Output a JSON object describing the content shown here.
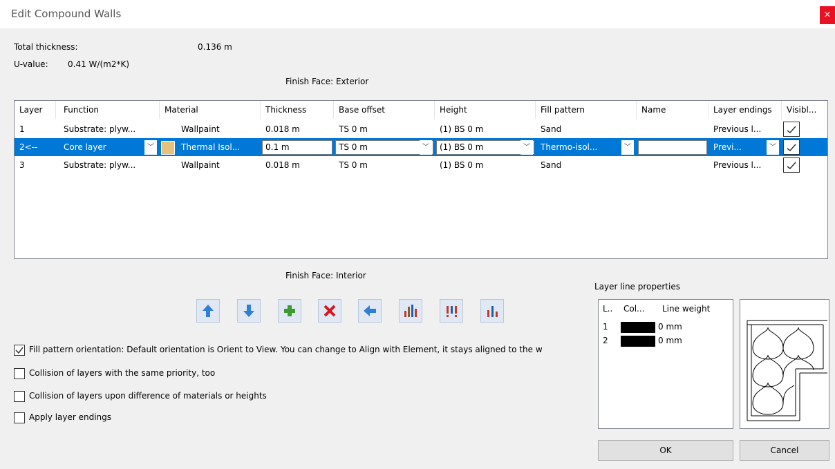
{
  "window": {
    "title": "Edit Compound Walls",
    "close_glyph": "×"
  },
  "summary": {
    "total_thickness_label": "Total thickness:",
    "total_thickness_value": "0.136 m",
    "u_value_label": "U-value:",
    "u_value_value": "0.41 W/(m2*K)"
  },
  "finish_exterior": "Finish Face: Exterior",
  "finish_interior": "Finish Face: Interior",
  "columns": [
    "Layer",
    "Function",
    "Material",
    "Thickness",
    "Base offset",
    "Height",
    "Fill pattern",
    "Name",
    "Layer endings",
    "Visibl..."
  ],
  "rows": [
    {
      "layer": "1",
      "function": "Substrate: plyw...",
      "material": "Wallpaint",
      "thickness": "0.018 m",
      "base_offset": "TS 0 m",
      "height": "(1) BS 0 m",
      "fill_pattern": "Sand",
      "name": "",
      "layer_endings": "Previous l...",
      "visible": true
    },
    {
      "layer": "2<--",
      "function": "Core layer",
      "material": "Thermal Isol...",
      "thickness": "0.1 m",
      "base_offset": "TS 0 m",
      "height": "(1) BS 0 m",
      "fill_pattern": "Thermo-isol...",
      "name": "",
      "layer_endings": "Previ...",
      "visible": true,
      "selected": true,
      "swatch_color": "#e8c27a"
    },
    {
      "layer": "3",
      "function": "Substrate: plyw...",
      "material": "Wallpaint",
      "thickness": "0.018 m",
      "base_offset": "TS 0 m",
      "height": "(1) BS 0 m",
      "fill_pattern": "Sand",
      "name": "",
      "layer_endings": "Previous l...",
      "visible": true
    }
  ],
  "toolbar_icons": [
    "move-up-icon",
    "move-down-icon",
    "add-layer-icon",
    "delete-layer-icon",
    "insert-left-icon",
    "bars-1-icon",
    "bars-2-icon",
    "bars-3-icon"
  ],
  "options": [
    {
      "label": "Fill pattern orientation: Default orientation is Orient to View. You can change to Align with Element, it stays aligned to the w",
      "checked": true
    },
    {
      "label": "Collision of layers with the same priority, too",
      "checked": false
    },
    {
      "label": "Collision of layers upon difference of materials or heights",
      "checked": false
    },
    {
      "label": "Apply layer endings",
      "checked": false
    }
  ],
  "layer_line": {
    "title": "Layer line properties",
    "columns": [
      "L..",
      "Col...",
      "Line weight"
    ],
    "rows": [
      {
        "l": "1",
        "color": "#000000",
        "weight": "0 mm"
      },
      {
        "l": "2",
        "color": "#000000",
        "weight": "0 mm"
      }
    ]
  },
  "buttons": {
    "ok": "OK",
    "cancel": "Cancel"
  },
  "colors": {
    "selection": "#0078d7",
    "close": "#e81123"
  }
}
